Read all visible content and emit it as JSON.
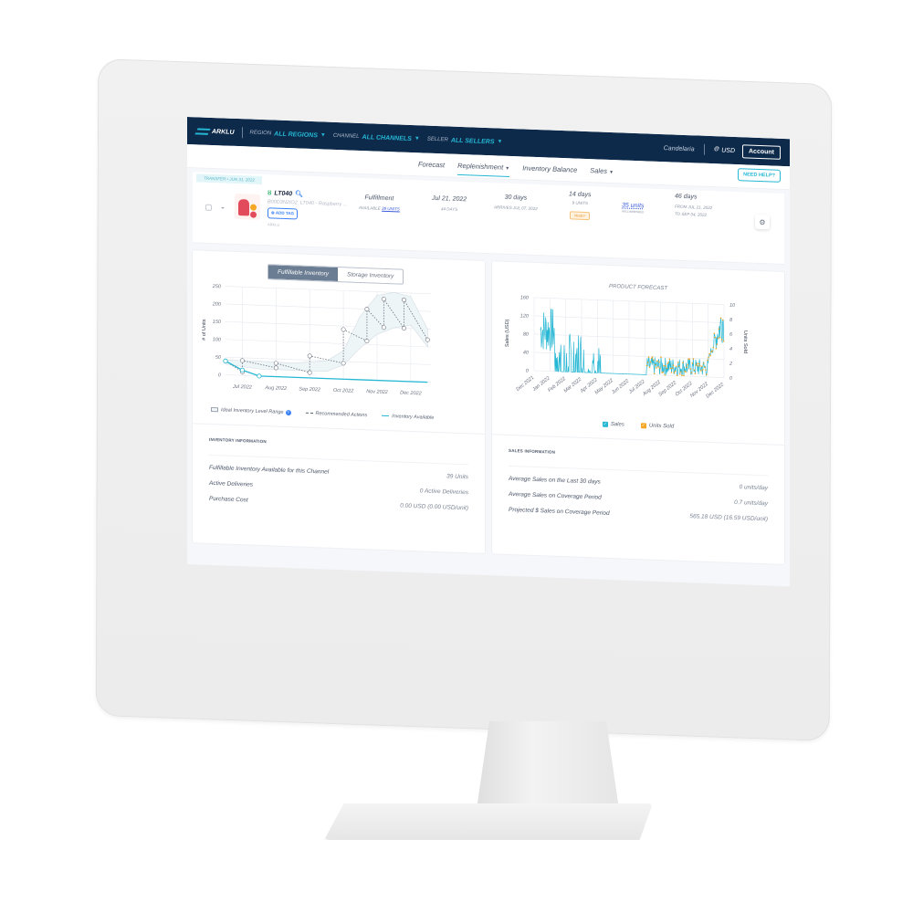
{
  "topbar": {
    "brand": "ARKLU",
    "filters": [
      {
        "label": "REGION",
        "value": "ALL REGIONS"
      },
      {
        "label": "CHANNEL",
        "value": "ALL CHANNELS"
      },
      {
        "label": "SELLER",
        "value": "ALL SELLERS"
      }
    ],
    "user": "Candelaria",
    "currency": "USD",
    "account_label": "Account"
  },
  "navbar": {
    "items": [
      {
        "label": "Forecast",
        "has_dropdown": false,
        "active": false
      },
      {
        "label": "Replenishment",
        "has_dropdown": true,
        "active": true
      },
      {
        "label": "Inventory Balance",
        "has_dropdown": false,
        "active": false
      },
      {
        "label": "Sales",
        "has_dropdown": true,
        "active": false
      }
    ],
    "help_label": "NEED HELP?"
  },
  "product": {
    "transfer_tag": "TRANSFER • JUN 31, 2022",
    "sku": "LT040",
    "asin_title": "B00D3N2IO2_LT040 - Raspberry ...",
    "add_tag_label": "ADD TAG",
    "small_id": "ARKLU",
    "fulfillment": {
      "main": "Fulfillment",
      "sub_prefix": "AVAILABLE",
      "sub_link": "39 UNITS"
    },
    "date": {
      "main": "Jul 21, 2022",
      "sub": "44 DAYS"
    },
    "lead_time": {
      "main": "30 days",
      "sub": "ARRIVES JUL 07, 2022"
    },
    "safety": {
      "main": "14 days",
      "sub": "9 UNITS",
      "badge": "RISKY"
    },
    "recommended": {
      "main": "35 units",
      "sub": "RECOMMENDED"
    },
    "coverage": {
      "main": "46 days",
      "from": "FROM JUL 21, 2022",
      "to": "TO SEP 04, 2022"
    }
  },
  "inventory_chart": {
    "toggle": [
      "Fulfillable Inventory",
      "Storage Inventory"
    ],
    "legend": [
      "Ideal Inventory Level Range",
      "Recommended Actions",
      "Inventory Available"
    ]
  },
  "forecast_chart": {
    "legend": [
      "Sales",
      "Units Sold"
    ]
  },
  "inventory_info": {
    "title": "INVENTORY INFORMATION",
    "rows": [
      {
        "label": "Fulfillable Inventory Available for this Channel",
        "value": "39 Units"
      },
      {
        "label": "Active Deliveries",
        "value": "0 Active Deliveries"
      },
      {
        "label": "Purchase Cost",
        "value": "0.00 USD (0.00 USD/unit)"
      }
    ]
  },
  "sales_info": {
    "title": "SALES INFORMATION",
    "rows": [
      {
        "label": "Average Sales on the Last 30 days",
        "value": "0 units/day"
      },
      {
        "label": "Average Sales on Coverage Period",
        "value": "0.7 units/day"
      },
      {
        "label": "Projected $ Sales on Coverage Period",
        "value": "565.18 USD (16.59 USD/unit)"
      }
    ]
  },
  "colors": {
    "navy": "#0d2a4b",
    "accent": "#25b7d3",
    "link": "#3b5bdb",
    "warning": "#f5a623"
  },
  "chart_data": [
    {
      "type": "line",
      "title": "",
      "xlabel": "",
      "ylabel": "# of Units",
      "x_ticks": [
        "Jul 2022",
        "Aug 2022",
        "Sep 2022",
        "Oct 2022",
        "Nov 2022",
        "Dec 2022"
      ],
      "y_ticks": [
        0,
        50,
        100,
        150,
        200,
        250
      ],
      "ylim": [
        0,
        250
      ],
      "xlim_months": [
        -0.5,
        5.6
      ],
      "series": [
        {
          "name": "Inventory Available",
          "x": [
            -0.5,
            0.0,
            0.5
          ],
          "y": [
            39,
            15,
            0
          ]
        },
        {
          "name": "Recommended Actions",
          "x": [
            -0.5,
            0.0,
            0.0,
            1.0,
            1.0,
            2.0,
            2.0,
            3.0,
            3.0,
            3.7,
            3.7,
            4.2,
            4.2,
            4.8,
            4.8,
            5.5
          ],
          "y": [
            39,
            10,
            42,
            25,
            38,
            15,
            62,
            45,
            140,
            110,
            200,
            150,
            230,
            150,
            230,
            120
          ]
        },
        {
          "name": "Ideal Inventory Level Range",
          "x": [
            -0.5,
            0.5,
            1.5,
            2.5,
            3.0,
            3.5,
            4.0,
            4.5,
            5.0,
            5.5
          ],
          "lower": [
            30,
            20,
            20,
            20,
            40,
            90,
            130,
            150,
            160,
            100
          ],
          "upper": [
            42,
            42,
            40,
            50,
            80,
            180,
            240,
            250,
            240,
            150
          ]
        }
      ]
    },
    {
      "type": "line",
      "title": "PRODUCT FORECAST",
      "ylabel": "Sales (USD)",
      "y2label": "Units Sold",
      "x_ticks": [
        "Dec 2021",
        "Jan 2022",
        "Feb 2022",
        "Mar 2022",
        "Apr 2022",
        "May 2022",
        "Jun 2022",
        "Jul 2022",
        "Aug 2022",
        "Sep 2022",
        "Oct 2022",
        "Nov 2022",
        "Dec 2022"
      ],
      "y_ticks": [
        0,
        40,
        80,
        120,
        160
      ],
      "y2_ticks": [
        0,
        2,
        4,
        6,
        8,
        10
      ],
      "ylim": [
        0,
        160
      ],
      "y2lim": [
        0,
        10
      ],
      "series": [
        {
          "name": "Sales",
          "note": "daily; spiky 0-140 Dec 2021-Apr 2022, flat 0 Apr-Jun 2022, forecast 0-40 Jul-Nov 2022 rising to ~160 Dec 2022"
        },
        {
          "name": "Units Sold",
          "note": "daily; 0-2.5 through Nov 2022 rising to ~10 Dec 2022"
        }
      ]
    }
  ]
}
